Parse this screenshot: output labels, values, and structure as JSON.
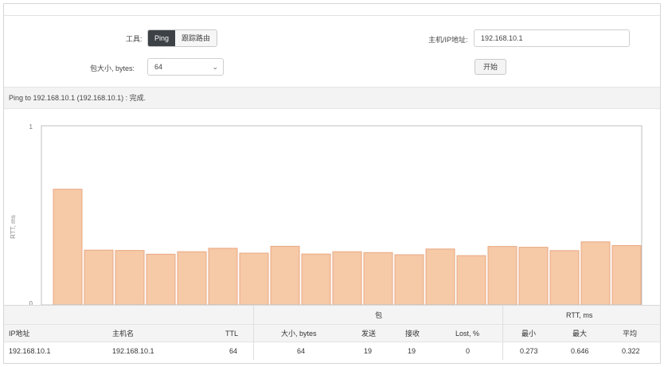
{
  "form": {
    "tool_label": "工具:",
    "tool_options": [
      "Ping",
      "跟踪路由"
    ],
    "host_label": "主机/IP地址:",
    "host_value": "192.168.10.1",
    "size_label": "包大小, bytes:",
    "size_value": "64",
    "start_label": "开始"
  },
  "status": {
    "text": "Ping to 192.168.10.1 (192.168.10.1) : 完成."
  },
  "chart_data": {
    "type": "bar",
    "ylabel": "RTT, ms",
    "ylim": [
      0,
      1
    ],
    "yticks": [
      "0",
      "1"
    ],
    "values": [
      0.646,
      0.306,
      0.304,
      0.283,
      0.297,
      0.316,
      0.289,
      0.327,
      0.284,
      0.297,
      0.292,
      0.28,
      0.312,
      0.275,
      0.326,
      0.322,
      0.303,
      0.352,
      0.331
    ],
    "bar_color": "#f6c9a7",
    "bar_stroke": "#e9a780"
  },
  "table": {
    "group_headers": {
      "packets": "包",
      "rtt": "RTT, ms"
    },
    "columns": [
      "IP地址",
      "主机名",
      "TTL",
      "大小, bytes",
      "发送",
      "接收",
      "Lost, %",
      "最小",
      "最大",
      "平均"
    ],
    "rows": [
      [
        "192.168.10.1",
        "192.168.10.1",
        "64",
        "64",
        "19",
        "19",
        "0",
        "0.273",
        "0.646",
        "0.322"
      ]
    ]
  }
}
